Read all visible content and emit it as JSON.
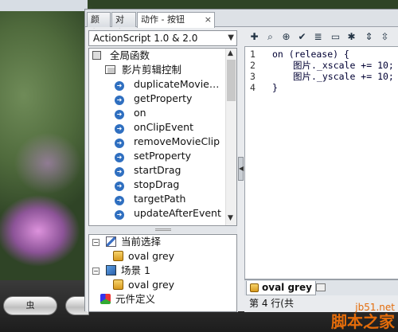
{
  "background": {
    "oval_button_label": "虫"
  },
  "panel": {
    "tabs": [
      {
        "label": "颜色"
      },
      {
        "label": "对齐"
      },
      {
        "label": "动作 - 按钮",
        "close": "×"
      }
    ]
  },
  "actions_toolbox": {
    "version_select": "ActionScript 1.0 & 2.0",
    "tree": {
      "root": "全局函数",
      "folder": "影片剪辑控制",
      "items": [
        "duplicateMovie…",
        "getProperty",
        "on",
        "onClipEvent",
        "removeMovieClip",
        "setProperty",
        "startDrag",
        "stopDrag",
        "targetPath",
        "updateAfterEvent"
      ]
    }
  },
  "script_navigator": {
    "current_selection": "当前选择",
    "current_item": "oval grey",
    "scene": "场景 1",
    "scene_item": "oval grey",
    "components": "元件定义"
  },
  "toolbar": {
    "icons": [
      "add-icon",
      "find-icon",
      "target-icon",
      "check-syntax-icon",
      "auto-format-icon",
      "code-hint-icon",
      "debug-icon",
      "collapse-icon",
      "expand-icon"
    ]
  },
  "editor": {
    "line_numbers": [
      "1",
      "2",
      "3",
      "4"
    ],
    "lines": [
      "on (release) {",
      "图片._xscale += 10;",
      "图片._yscale += 10;",
      "}"
    ]
  },
  "script_tab": {
    "label": "oval grey"
  },
  "status": {
    "text": "第 4 行(共"
  },
  "watermark": {
    "top": "jb51.net",
    "main": "脚本之家"
  },
  "colors": {
    "panel_bg": "#e9ebee",
    "icon_blue": "#2f6fc0",
    "watermark": "#e46c0a"
  }
}
